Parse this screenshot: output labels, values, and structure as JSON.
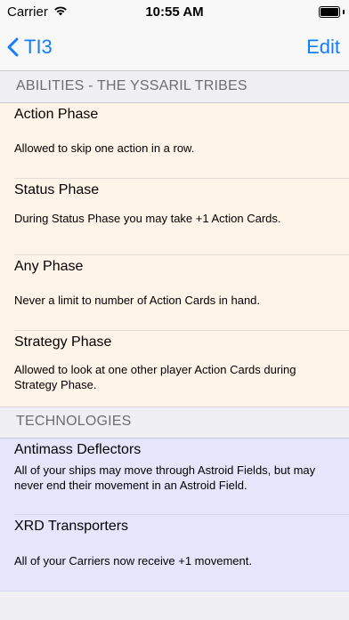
{
  "status_bar": {
    "carrier": "Carrier",
    "time": "10:55 AM"
  },
  "nav": {
    "back_label": "TI3",
    "edit_label": "Edit"
  },
  "sections": {
    "abilities": {
      "header": "ABILITIES - THE YSSARIL TRIBES",
      "items": [
        {
          "title": "Action Phase",
          "description": "Allowed to skip one action in a row."
        },
        {
          "title": "Status Phase",
          "description": "During Status Phase you may take +1 Action Cards."
        },
        {
          "title": "Any Phase",
          "description": "Never a limit to number of Action Cards in hand."
        },
        {
          "title": "Strategy Phase",
          "description": "Allowed to look at one other player Action Cards during Strategy Phase."
        }
      ]
    },
    "technologies": {
      "header": "TECHNOLOGIES",
      "items": [
        {
          "title": "Antimass Deflectors",
          "description": "All of your ships may move through Astroid Fields, but may never end their movement in an Astroid Field."
        },
        {
          "title": "XRD Transporters",
          "description": "All of your Carriers now receive +1 movement."
        }
      ]
    }
  },
  "colors": {
    "accent": "#147efb",
    "ability_bg": "#fff4e8",
    "tech_bg": "#e5e6fb"
  },
  "icons": {
    "wifi": "wifi-icon",
    "battery": "battery-icon",
    "back": "chevron-left-icon"
  }
}
